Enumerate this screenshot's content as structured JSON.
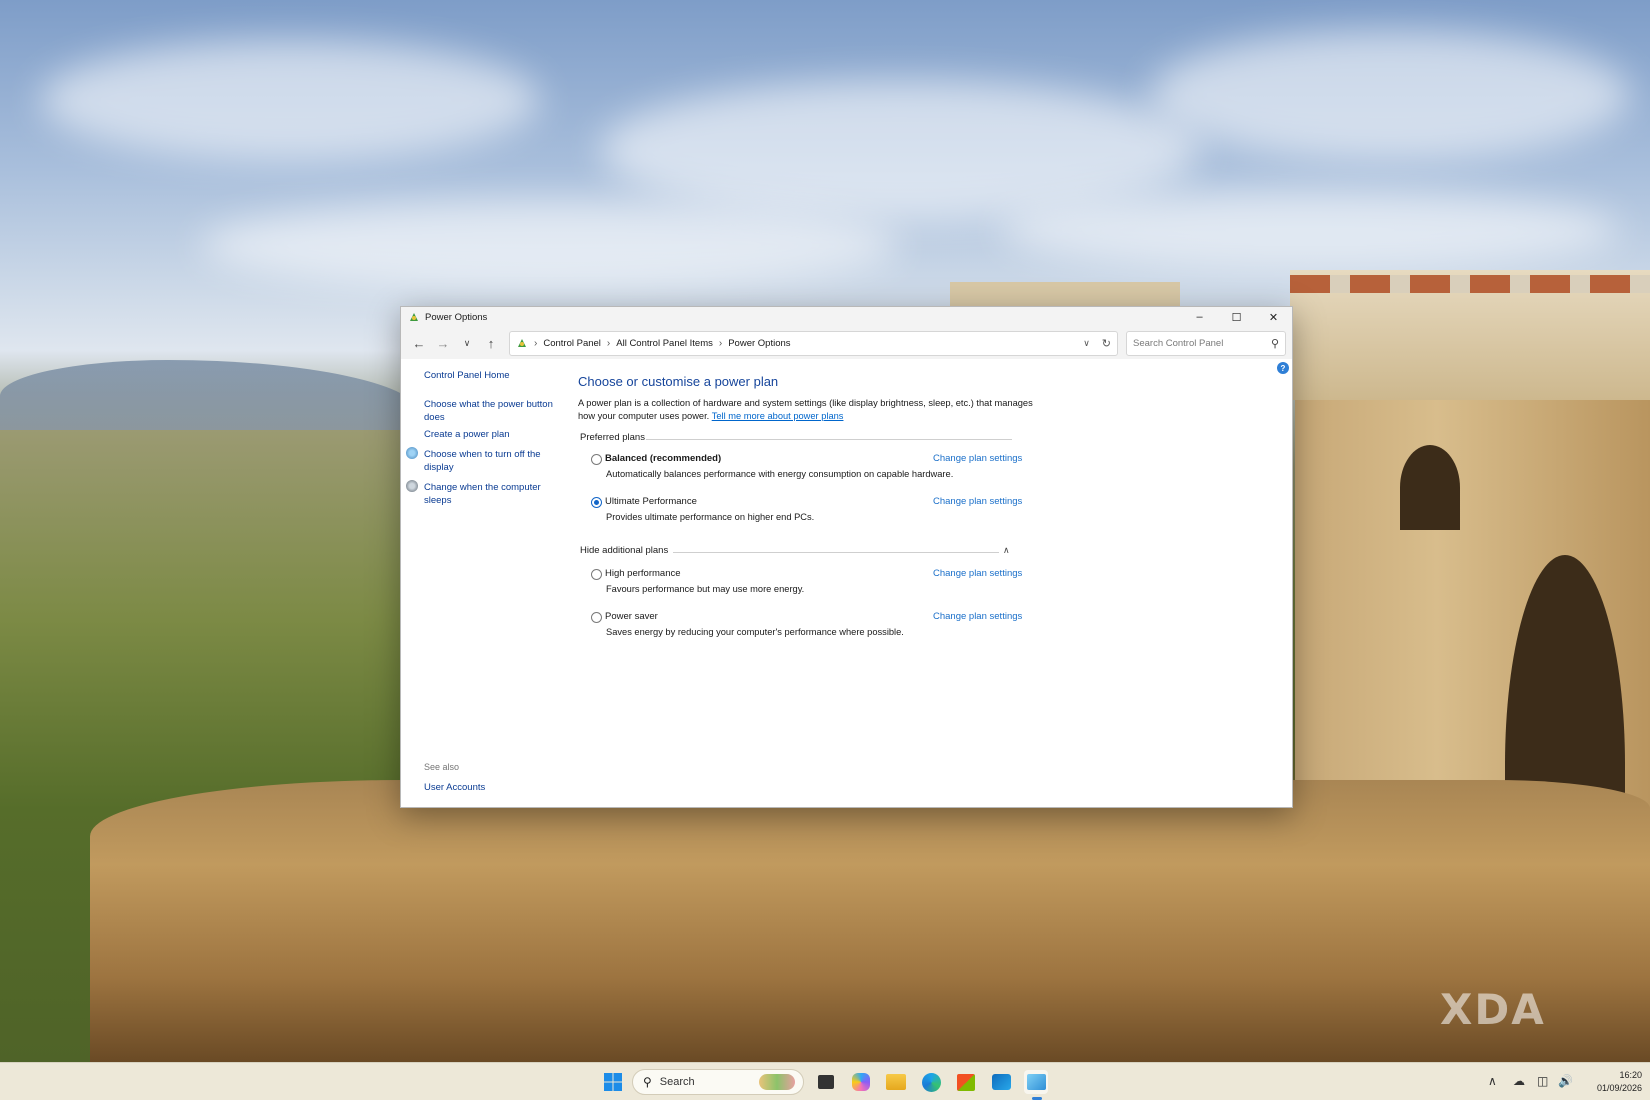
{
  "window": {
    "title": "Power Options",
    "breadcrumb": [
      "Control Panel",
      "All Control Panel Items",
      "Power Options"
    ],
    "search_placeholder": "Search Control Panel"
  },
  "sidebar": {
    "home": "Control Panel Home",
    "links": [
      "Choose what the power button does",
      "Create a power plan",
      "Choose when to turn off the display",
      "Change when the computer sleeps"
    ],
    "see_also_label": "See also",
    "see_also_links": [
      "User Accounts"
    ]
  },
  "main": {
    "heading": "Choose or customise a power plan",
    "description": "A power plan is a collection of hardware and system settings (like display brightness, sleep, etc.) that manages how your computer uses power.",
    "learn_more_link": "Tell me more about power plans",
    "preferred_label": "Preferred plans",
    "additional_label": "Hide additional plans",
    "change_link": "Change plan settings",
    "plans": [
      {
        "name": "Balanced (recommended)",
        "description": "Automatically balances performance with energy consumption on capable hardware.",
        "selected": false
      },
      {
        "name": "Ultimate Performance",
        "description": "Provides ultimate performance on higher end PCs.",
        "selected": true
      },
      {
        "name": "High performance",
        "description": "Favours performance but may use more energy.",
        "selected": false
      },
      {
        "name": "Power saver",
        "description": "Saves energy by reducing your computer's performance where possible.",
        "selected": false
      }
    ]
  },
  "taskbar": {
    "search_label": "Search",
    "time": "16:20",
    "date": "01/09/2026"
  },
  "watermark": "XDA",
  "colors": {
    "link": "#0a3b92",
    "heading": "#16459b",
    "accent": "#1366c8"
  }
}
